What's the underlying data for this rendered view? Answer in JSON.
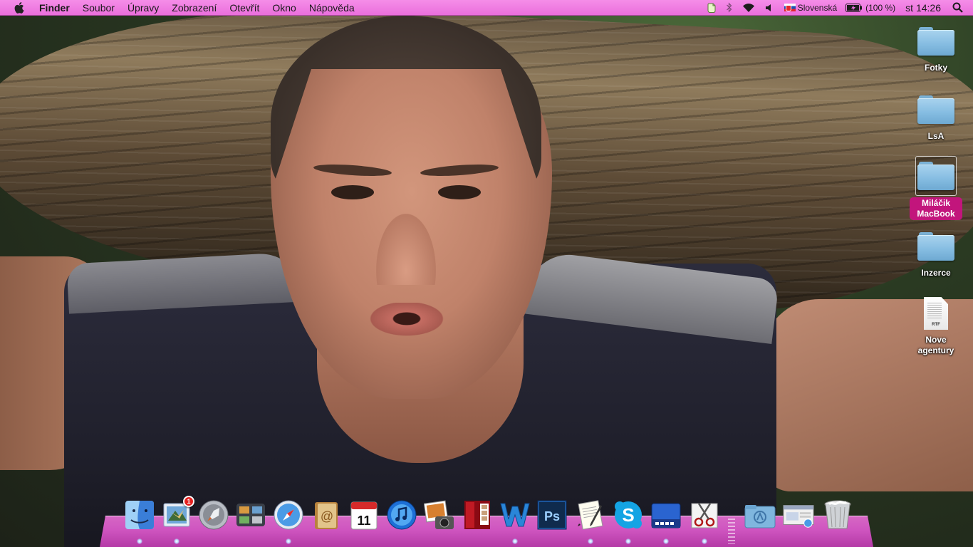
{
  "menubar": {
    "app_name": "Finder",
    "menus": [
      "Soubor",
      "Úpravy",
      "Zobrazení",
      "Otevřít",
      "Okno",
      "Nápověda"
    ],
    "input_source": "Slovenská",
    "battery": "(100 %)",
    "clock": "st 14:26"
  },
  "desktop": {
    "icons": [
      {
        "label": "Fotky",
        "kind": "folder",
        "selected": false
      },
      {
        "label": "LsA",
        "kind": "folder",
        "selected": false
      },
      {
        "label": "Miláčik MacBook",
        "kind": "folder",
        "selected": true
      },
      {
        "label": "Inzerce",
        "kind": "folder",
        "selected": false
      },
      {
        "label": "Nove agentury",
        "kind": "rtf-document",
        "selected": false,
        "badge_text": "RTF"
      }
    ]
  },
  "dock": {
    "apps": [
      {
        "id": "finder",
        "icon": "finder-icon",
        "running": true
      },
      {
        "id": "mail",
        "icon": "mail-icon",
        "running": true,
        "badge": "1"
      },
      {
        "id": "launchpad",
        "icon": "launchpad-icon",
        "running": false
      },
      {
        "id": "mission-control",
        "icon": "mission-control-icon",
        "running": false
      },
      {
        "id": "safari",
        "icon": "safari-icon",
        "running": true
      },
      {
        "id": "contacts",
        "icon": "address-book-icon",
        "running": false
      },
      {
        "id": "calendar",
        "icon": "calendar-icon",
        "running": false,
        "calendar_day": "11"
      },
      {
        "id": "itunes",
        "icon": "itunes-icon",
        "running": false
      },
      {
        "id": "iphoto",
        "icon": "iphoto-icon",
        "running": false
      },
      {
        "id": "photo-booth",
        "icon": "photo-booth-icon",
        "running": false
      },
      {
        "id": "word",
        "icon": "word-icon",
        "running": true
      },
      {
        "id": "photoshop",
        "icon": "photoshop-icon",
        "running": false
      },
      {
        "id": "textedit",
        "icon": "textedit-icon",
        "running": true
      },
      {
        "id": "skype",
        "icon": "skype-icon",
        "running": true
      },
      {
        "id": "keynote-remote",
        "icon": "screen-sharing-icon",
        "running": true
      },
      {
        "id": "utility",
        "icon": "scissors-icon",
        "running": true
      }
    ],
    "stacks": [
      {
        "id": "applications-stack",
        "icon": "applications-folder-icon"
      },
      {
        "id": "downloads-stack",
        "icon": "downloads-stack-icon"
      },
      {
        "id": "trash",
        "icon": "trash-icon"
      }
    ],
    "colors": {
      "shelf": "#cf55c0",
      "menubar": "#f07fe3",
      "selection": "#c2157c"
    }
  }
}
